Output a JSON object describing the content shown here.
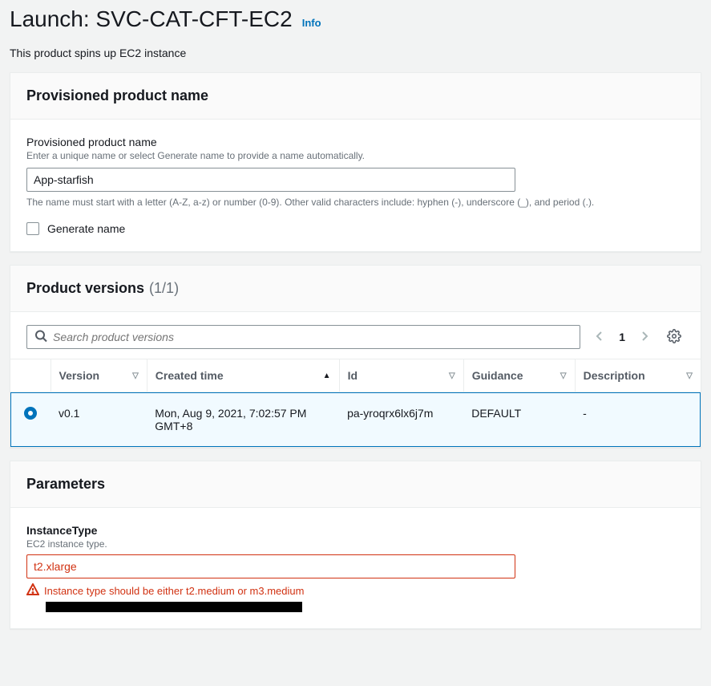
{
  "header": {
    "title": "Launch: SVC-CAT-CFT-EC2",
    "info": "Info",
    "description": "This product spins up EC2 instance"
  },
  "provisioned": {
    "panel_title": "Provisioned product name",
    "field_label": "Provisioned product name",
    "field_hint": "Enter a unique name or select Generate name to provide a name automatically.",
    "value": "App-starfish",
    "field_note": "The name must start with a letter (A-Z, a-z) or number (0-9). Other valid characters include: hyphen (-), underscore (_), and period (.).",
    "generate_label": "Generate name"
  },
  "versions": {
    "panel_title": "Product versions",
    "count": "(1/1)",
    "search_placeholder": "Search product versions",
    "page_num": "1",
    "cols": {
      "version": "Version",
      "created": "Created time",
      "id": "Id",
      "guidance": "Guidance",
      "description": "Description"
    },
    "row": {
      "version": "v0.1",
      "created": "Mon, Aug 9, 2021, 7:02:57 PM GMT+8",
      "id": "pa-yroqrx6lx6j7m",
      "guidance": "DEFAULT",
      "description": "-"
    }
  },
  "parameters": {
    "panel_title": "Parameters",
    "instance_type": {
      "label": "InstanceType",
      "hint": "EC2 instance type.",
      "value": "t2.xlarge",
      "error": "Instance type should be either t2.medium or m3.medium"
    }
  }
}
